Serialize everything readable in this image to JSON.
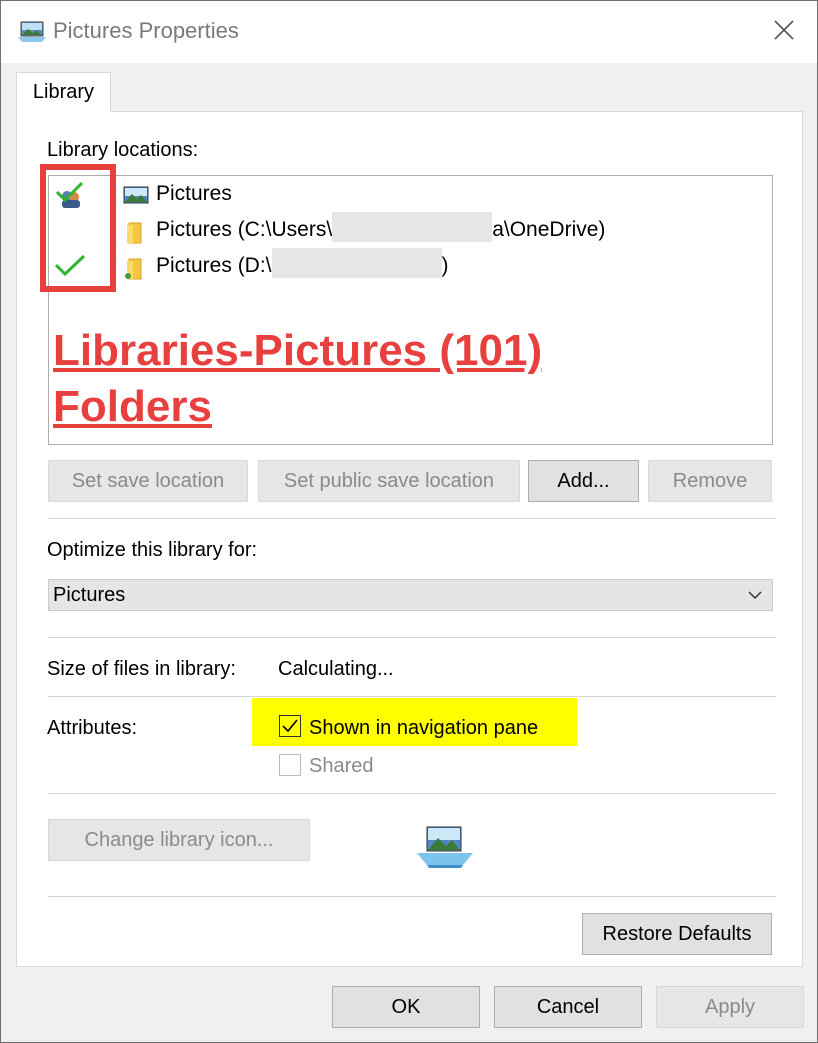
{
  "window": {
    "title": "Pictures Properties",
    "close_icon": "close-icon"
  },
  "tabs": [
    {
      "label": "Library",
      "active": true
    }
  ],
  "library_locations": {
    "label": "Library locations:",
    "items": [
      {
        "text": "Pictures",
        "icon": "pictures-library-icon",
        "status": "default-save-and-public"
      },
      {
        "text": "Pictures (C:\\Users\\",
        "text_tail": "a\\OneDrive)",
        "icon": "folder-icon",
        "status": "none"
      },
      {
        "text": "Pictures (D:\\",
        "text_tail": ")",
        "icon": "folder-icon",
        "status": "checked"
      }
    ]
  },
  "annotation": {
    "line1": "Libraries-Pictures (101) ",
    "line2": "Folders",
    "color": "#e8403f"
  },
  "location_buttons": {
    "set_save": "Set save location",
    "set_public": "Set public save location",
    "add": "Add...",
    "remove": "Remove"
  },
  "optimize": {
    "label": "Optimize this library for:",
    "value": "Pictures"
  },
  "size": {
    "label": "Size of files in library:",
    "value": "Calculating..."
  },
  "attributes": {
    "label": "Attributes:",
    "shown_in_nav": {
      "label": "Shown in navigation pane",
      "checked": true
    },
    "shared": {
      "label": "Shared",
      "checked": false,
      "disabled": true
    },
    "highlight_color": "#ffff00"
  },
  "icon_section": {
    "change_icon_button": "Change library icon...",
    "library_icon": "pictures-library-icon"
  },
  "restore_defaults": "Restore Defaults",
  "footer": {
    "ok": "OK",
    "cancel": "Cancel",
    "apply": "Apply"
  }
}
